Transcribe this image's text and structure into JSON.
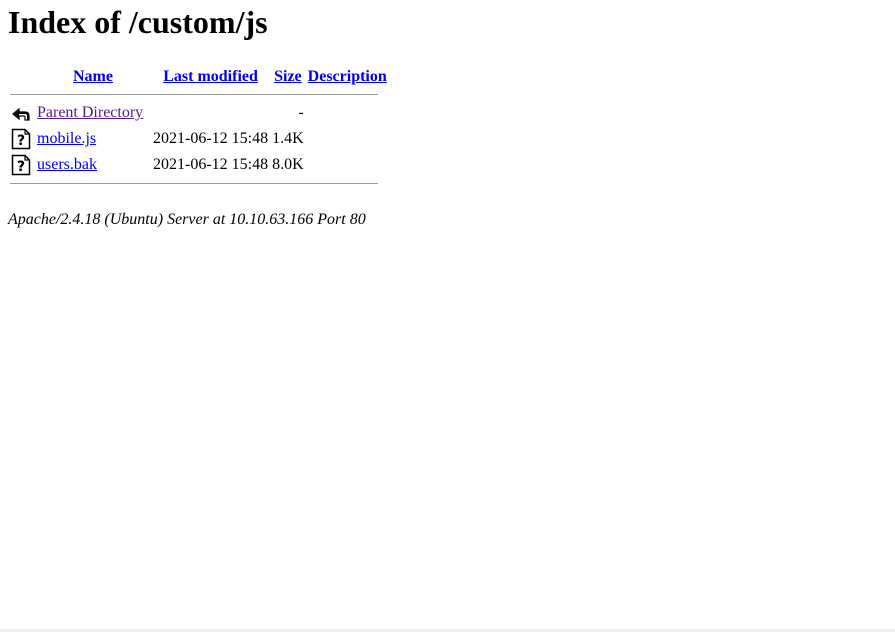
{
  "page": {
    "heading": "Index of /custom/js"
  },
  "table": {
    "headers": {
      "name": "Name",
      "last_modified": "Last modified",
      "size": "Size",
      "description": "Description"
    },
    "rows": [
      {
        "icon": "back-icon",
        "name": "Parent Directory",
        "modified": "",
        "size": "-",
        "description": "",
        "visited": true
      },
      {
        "icon": "unknown-file-icon",
        "name": "mobile.js",
        "modified": "2021-06-12 15:48",
        "size": "1.4K",
        "description": "",
        "visited": false
      },
      {
        "icon": "unknown-file-icon",
        "name": "users.bak",
        "modified": "2021-06-12 15:48",
        "size": "8.0K",
        "description": "",
        "visited": false
      }
    ]
  },
  "footer": {
    "server_signature": "Apache/2.4.18 (Ubuntu) Server at 10.10.63.166 Port 80"
  }
}
